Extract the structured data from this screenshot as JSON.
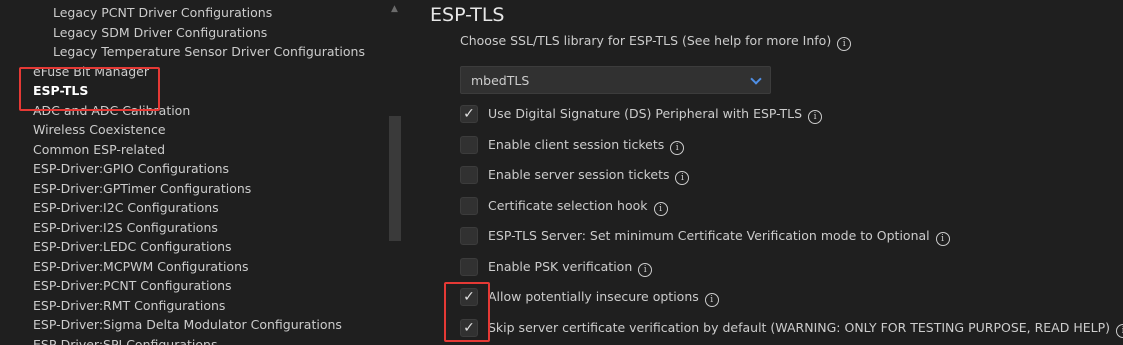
{
  "sidebar": {
    "items": [
      {
        "label": "Legacy PCNT Driver Configurations"
      },
      {
        "label": "Legacy SDM Driver Configurations"
      },
      {
        "label": "Legacy Temperature Sensor Driver Configurations"
      },
      {
        "label": "eFuse Bit Manager"
      },
      {
        "label": "ESP-TLS"
      },
      {
        "label": "ADC and ADC Calibration"
      },
      {
        "label": "Wireless Coexistence"
      },
      {
        "label": "Common ESP-related"
      },
      {
        "label": "ESP-Driver:GPIO Configurations"
      },
      {
        "label": "ESP-Driver:GPTimer Configurations"
      },
      {
        "label": "ESP-Driver:I2C Configurations"
      },
      {
        "label": "ESP-Driver:I2S Configurations"
      },
      {
        "label": "ESP-Driver:LEDC Configurations"
      },
      {
        "label": "ESP-Driver:MCPWM Configurations"
      },
      {
        "label": "ESP-Driver:PCNT Configurations"
      },
      {
        "label": "ESP-Driver:RMT Configurations"
      },
      {
        "label": "ESP-Driver:Sigma Delta Modulator Configurations"
      },
      {
        "label": "ESP-Driver:SPI Configurations"
      }
    ],
    "selected": "ESP-TLS"
  },
  "main": {
    "section_title": "ESP-TLS",
    "library_label": "Choose SSL/TLS library for ESP-TLS (See help for more Info)",
    "library_value": "mbedTLS",
    "checkboxes": [
      {
        "label": "Use Digital Signature (DS) Peripheral with ESP-TLS",
        "checked": true
      },
      {
        "label": "Enable client session tickets",
        "checked": false
      },
      {
        "label": "Enable server session tickets",
        "checked": false
      },
      {
        "label": "Certificate selection hook",
        "checked": false
      },
      {
        "label": "ESP-TLS Server: Set minimum Certificate Verification mode to Optional",
        "checked": false
      },
      {
        "label": "Enable PSK verification",
        "checked": false
      },
      {
        "label": "Allow potentially insecure options",
        "checked": true
      },
      {
        "label": "Skip server certificate verification by default (WARNING: ONLY FOR TESTING PURPOSE, READ HELP)",
        "checked": true
      }
    ]
  },
  "icons": {
    "info": "info-icon",
    "check": "check-icon",
    "chevron": "chevron-down-icon",
    "collapse": "collapse-arrow-icon"
  },
  "colors": {
    "background": "#1f1f1f",
    "highlight": "#e53935",
    "accent": "#4f8fe6"
  }
}
